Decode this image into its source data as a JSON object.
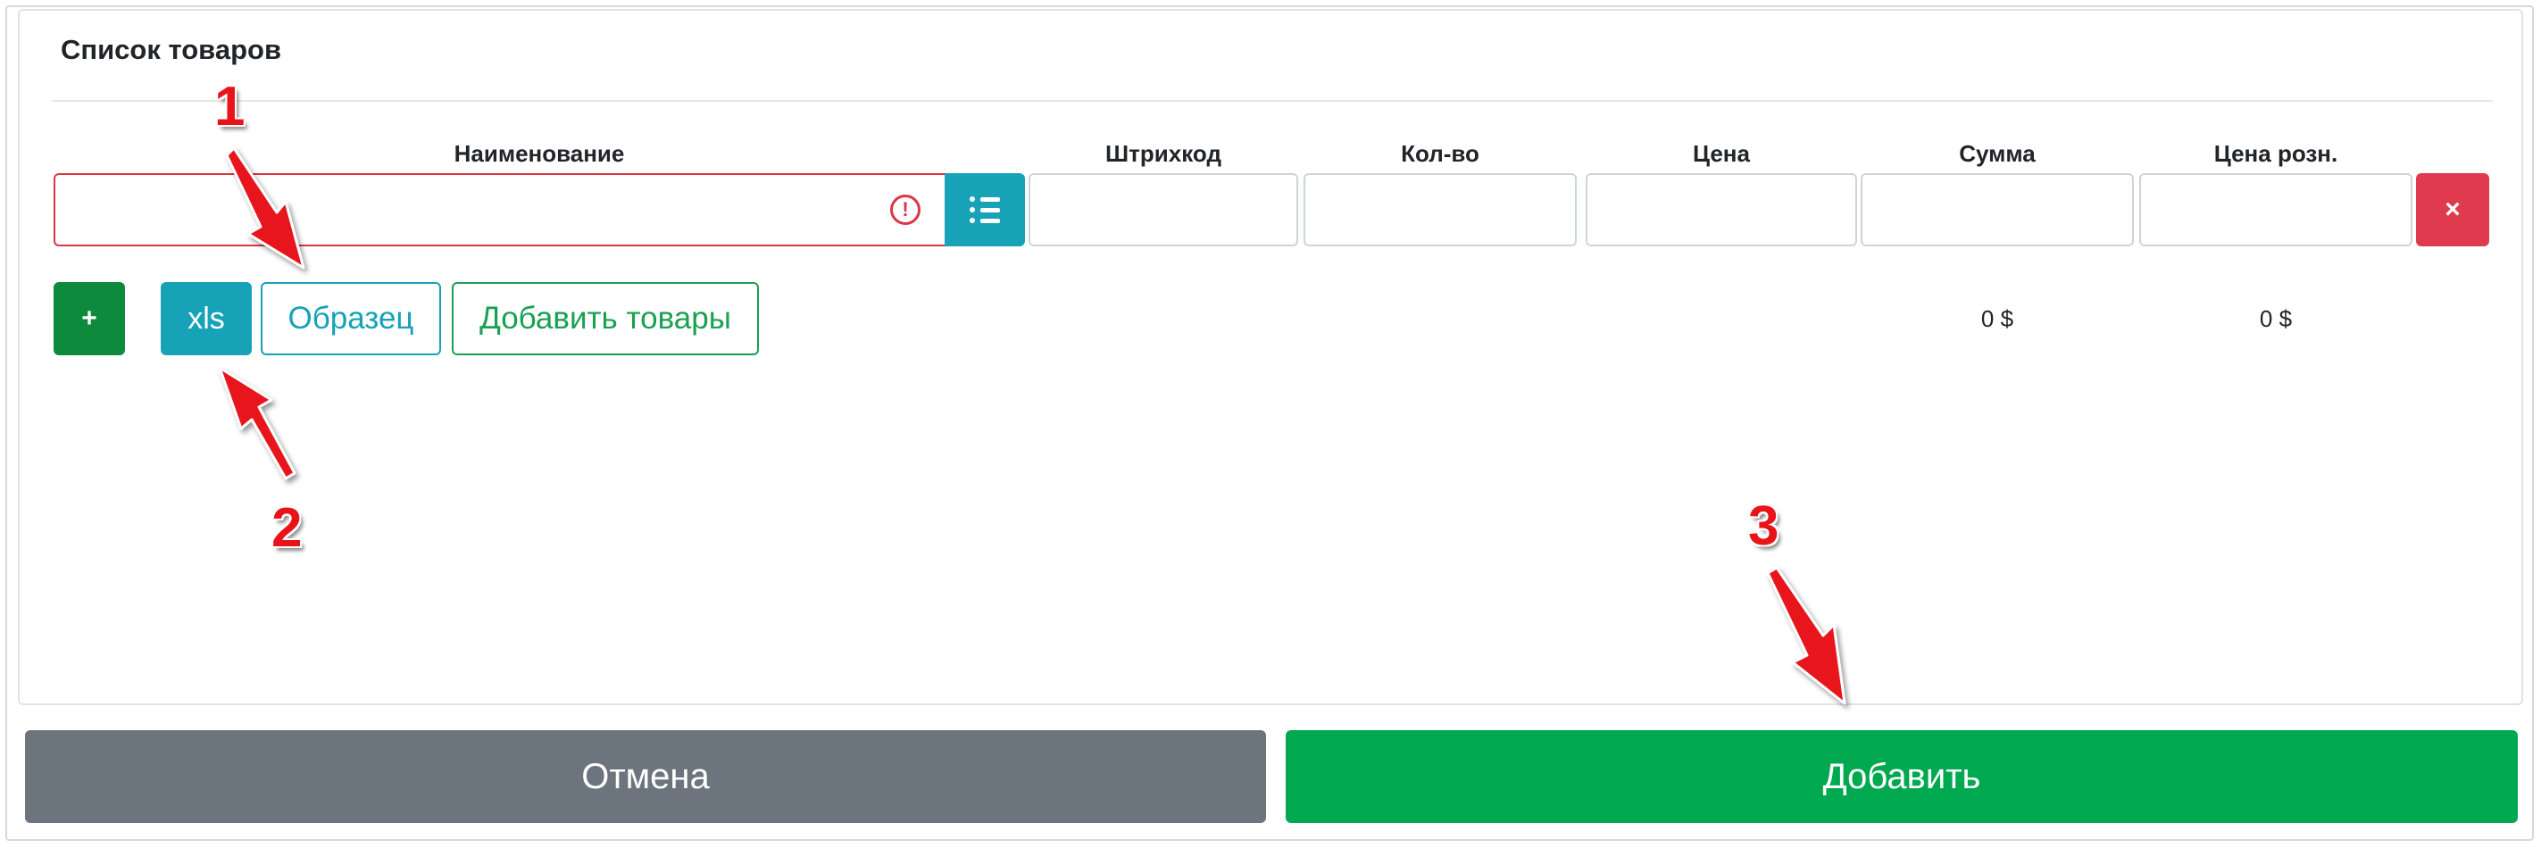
{
  "form": {
    "title": "Список товаров",
    "columns": {
      "name": "Наименование",
      "barcode": "Штрихкод",
      "qty": "Кол-во",
      "price": "Цена",
      "sum": "Сумма",
      "retail_price": "Цена розн."
    },
    "row": {
      "name_value": "",
      "barcode_value": "",
      "qty_value": "",
      "price_value": "",
      "sum_value": "",
      "retail_value": "",
      "error_icon": "!",
      "list_icon": "list-icon",
      "delete_label": "×"
    },
    "buttons": {
      "add_row": "+",
      "xls": "xls",
      "sample": "Образец",
      "add_goods": "Добавить товары"
    },
    "totals": {
      "sum": "0 $",
      "retail": "0 $"
    }
  },
  "footer": {
    "cancel": "Отмена",
    "add": "Добавить"
  },
  "annotations": {
    "callout_1": "1",
    "callout_2": "2",
    "callout_3": "3",
    "color": "#e8141a"
  },
  "colors": {
    "info": "#17a2b8",
    "success": "#00a84f",
    "danger": "#dc3545",
    "secondary": "#6c757d"
  }
}
